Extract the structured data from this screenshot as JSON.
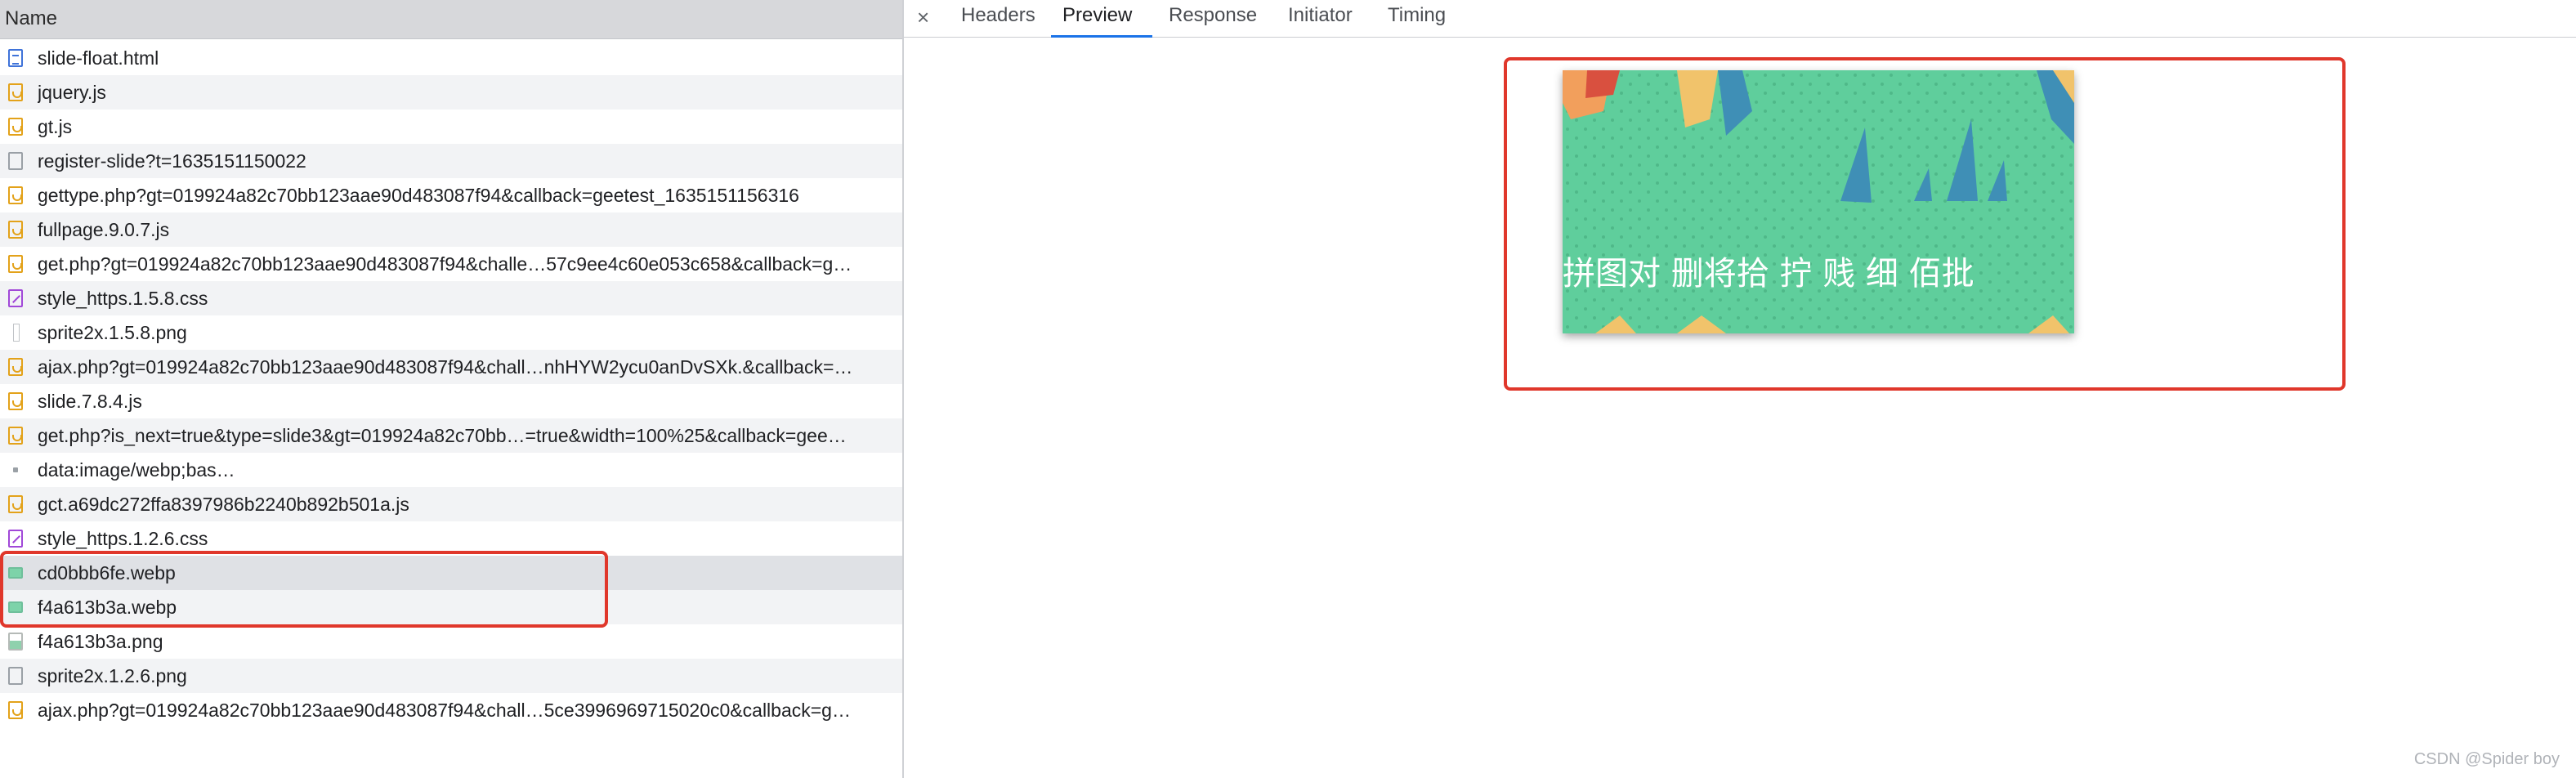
{
  "list": {
    "header": "Name",
    "rows": [
      {
        "name": "slide-float.html",
        "icon": "document-icon"
      },
      {
        "name": "jquery.js",
        "icon": "script-icon"
      },
      {
        "name": "gt.js",
        "icon": "script-icon"
      },
      {
        "name": "register-slide?t=1635151150022",
        "icon": "blank-file-icon"
      },
      {
        "name": "gettype.php?gt=019924a82c70bb123aae90d483087f94&callback=geetest_1635151156316",
        "icon": "script-icon"
      },
      {
        "name": "fullpage.9.0.7.js",
        "icon": "script-icon"
      },
      {
        "name": "get.php?gt=019924a82c70bb123aae90d483087f94&challe…57c9ee4c60e053c658&callback=g…",
        "icon": "script-icon"
      },
      {
        "name": "style_https.1.5.8.css",
        "icon": "stylesheet-icon"
      },
      {
        "name": "sprite2x.1.5.8.png",
        "icon": "thin-image-icon"
      },
      {
        "name": "ajax.php?gt=019924a82c70bb123aae90d483087f94&chall…nhHYW2ycu0anDvSXk.&callback=…",
        "icon": "script-icon"
      },
      {
        "name": "slide.7.8.4.js",
        "icon": "script-icon"
      },
      {
        "name": "get.php?is_next=true&type=slide3&gt=019924a82c70bb…=true&width=100%25&callback=gee…",
        "icon": "script-icon"
      },
      {
        "name": "data:image/webp;bas…",
        "icon": "data-icon"
      },
      {
        "name": "gct.a69dc272ffa8397986b2240b892b501a.js",
        "icon": "script-icon"
      },
      {
        "name": "style_https.1.2.6.css",
        "icon": "stylesheet-icon"
      },
      {
        "name": "cd0bbb6fe.webp",
        "icon": "image-icon"
      },
      {
        "name": "f4a613b3a.webp",
        "icon": "image-icon"
      },
      {
        "name": "f4a613b3a.png",
        "icon": "png-icon"
      },
      {
        "name": "sprite2x.1.2.6.png",
        "icon": "blank-file-icon"
      },
      {
        "name": "ajax.php?gt=019924a82c70bb123aae90d483087f94&chall…5ce3996969715020c0&callback=g…",
        "icon": "script-icon"
      }
    ]
  },
  "tabs": {
    "close": "×",
    "items": [
      "Headers",
      "Preview",
      "Response",
      "Initiator",
      "Timing"
    ],
    "active": "Preview"
  },
  "preview": {
    "caption_glyphs": "拼图对 删将拾  拧 贱 细  佰批"
  },
  "watermark": "CSDN @Spider boy",
  "colors": {
    "highlight": "#e0372b",
    "tab_active": "#1a73e8",
    "preview_bg": "#5fce9c"
  }
}
